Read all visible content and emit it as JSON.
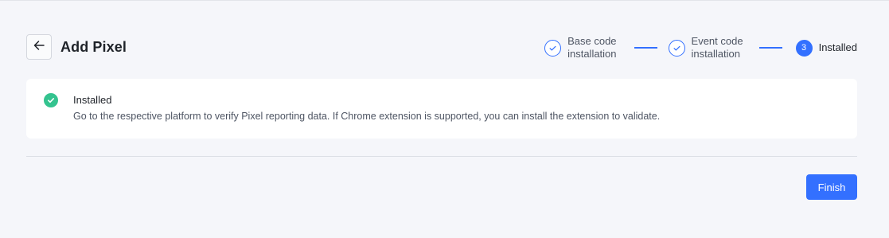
{
  "header": {
    "title": "Add Pixel",
    "back_icon": "arrow-left-icon"
  },
  "steps": [
    {
      "line1": "Base code",
      "line2": "installation",
      "status": "completed",
      "icon": "check-circle-icon"
    },
    {
      "line1": "Event code",
      "line2": "installation",
      "status": "completed",
      "icon": "check-circle-icon"
    },
    {
      "number": "3",
      "label": "Installed",
      "status": "current"
    }
  ],
  "card": {
    "title": "Installed",
    "description": "Go to the respective platform to verify Pixel reporting data. If Chrome extension is supported, you can install the extension to validate.",
    "icon": "success-check-icon"
  },
  "footer": {
    "finish_label": "Finish"
  },
  "colors": {
    "accent": "#3370ff",
    "success": "#34c38f",
    "background": "#f5f6fa"
  }
}
